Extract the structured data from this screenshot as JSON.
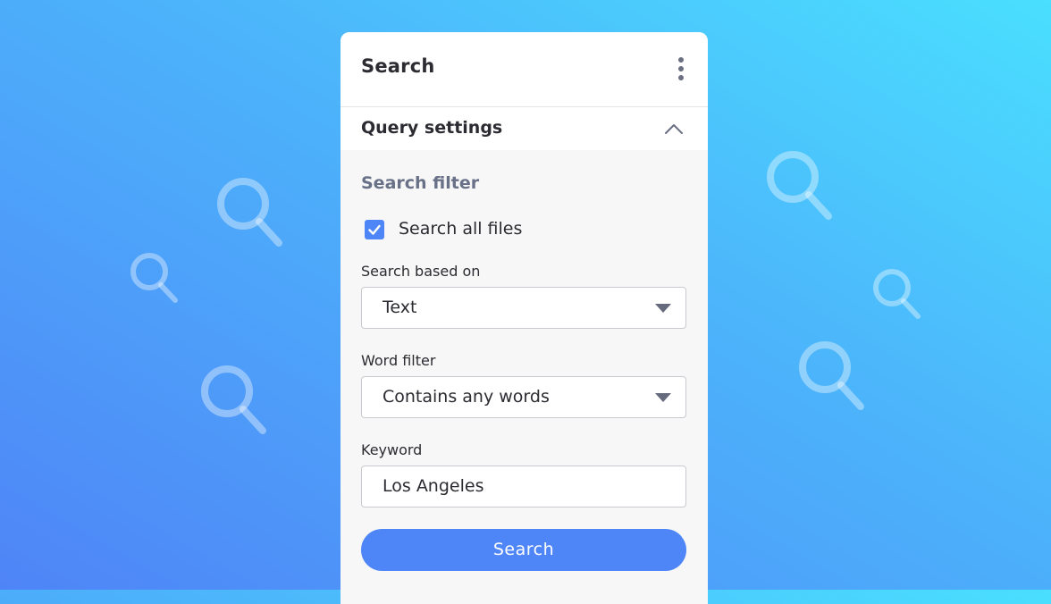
{
  "background_icons": [
    "search-icon",
    "search-icon",
    "search-icon",
    "search-icon",
    "search-icon",
    "search-icon"
  ],
  "colors": {
    "accent": "#4f86f7",
    "background_start": "#4f84f7",
    "background_end": "#4adffe",
    "panel": "#f7f7f7",
    "heading_muted": "#697188"
  },
  "panel": {
    "title": "Search",
    "menu_icon": "more-vertical-icon",
    "section": {
      "title": "Query settings",
      "toggle_icon": "chevron-up-icon",
      "expanded": true
    },
    "filter": {
      "heading": "Search filter",
      "search_all": {
        "label": "Search all files",
        "checked": true,
        "icon": "check-icon"
      },
      "based_on": {
        "label": "Search based on",
        "value": "Text",
        "icon": "caret-down-icon"
      },
      "word_filter": {
        "label": "Word filter",
        "value": "Contains any words",
        "icon": "caret-down-icon"
      },
      "keyword": {
        "label": "Keyword",
        "value": "Los Angeles"
      }
    },
    "search_button": "Search"
  }
}
